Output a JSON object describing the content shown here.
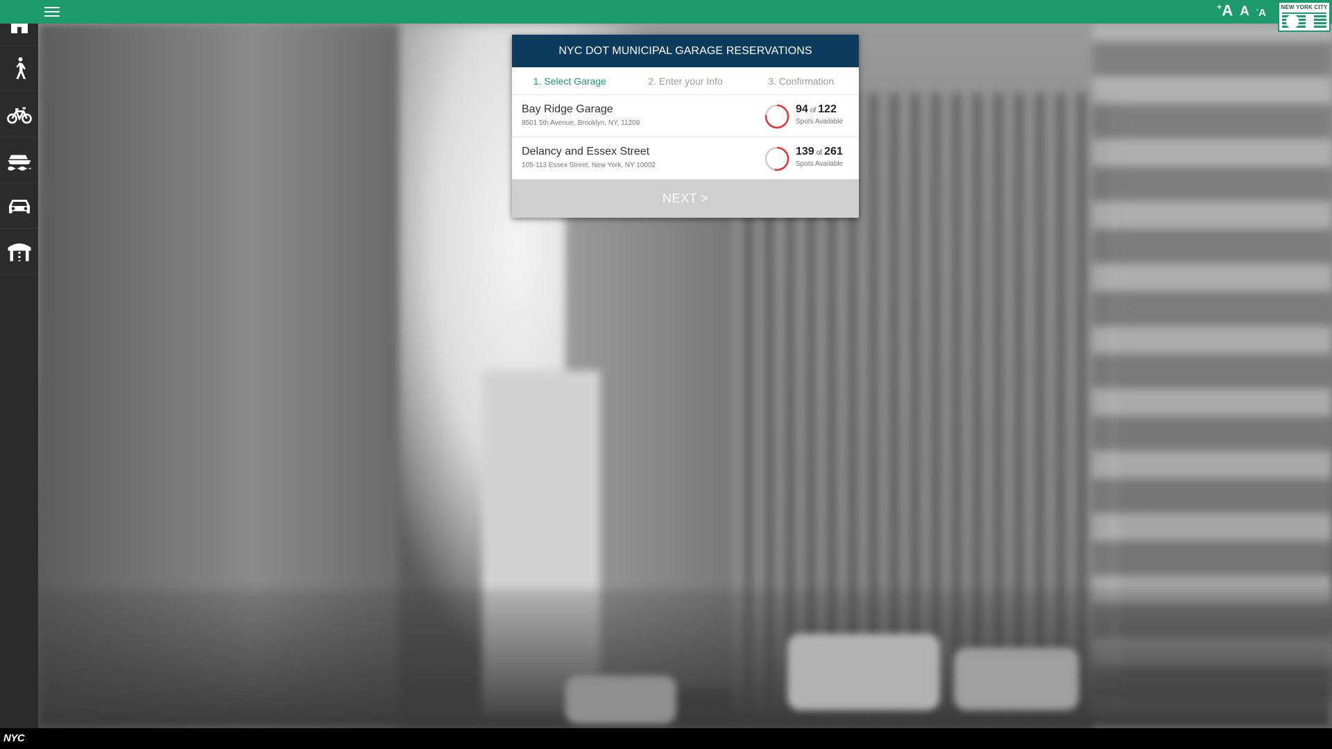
{
  "header": {
    "menu_icon": "hamburger-menu-icon",
    "font_controls": {
      "increase_label": "A",
      "normal_label": "A",
      "decrease_label": "A"
    },
    "logo_text": "NEW YORK CITY"
  },
  "sidebar": {
    "items": [
      {
        "name": "home",
        "icon": "home-icon"
      },
      {
        "name": "pedestrian",
        "icon": "pedestrian-icon"
      },
      {
        "name": "bicycle",
        "icon": "bicycle-icon"
      },
      {
        "name": "ferry",
        "icon": "ferry-icon"
      },
      {
        "name": "car",
        "icon": "car-icon"
      },
      {
        "name": "bridge",
        "icon": "bridge-icon"
      }
    ]
  },
  "panel": {
    "title": "NYC DOT MUNICIPAL GARAGE RESERVATIONS",
    "steps": [
      {
        "label": "1. Select Garage",
        "active": true
      },
      {
        "label": "2. Enter your Info",
        "active": false
      },
      {
        "label": "3. Confirmation",
        "active": false
      }
    ],
    "garages": [
      {
        "name": "Bay Ridge Garage",
        "address": "8501 5th Avenue, Brooklyn, NY, 11209",
        "available": "94",
        "of": "of",
        "total": "122",
        "label": "Spots Available",
        "ratio": 0.7705
      },
      {
        "name": "Delancy and Essex Street",
        "address": "105-113 Essex Street, New York, NY 10002",
        "available": "139",
        "of": "of",
        "total": "261",
        "label": "Spots Available",
        "ratio": 0.5326
      }
    ],
    "next_label": "NEXT >"
  },
  "footer": {
    "brand": "NYC"
  },
  "colors": {
    "topbar": "#1c9a6c",
    "panel_header": "#0d3b5e",
    "active_step": "#1c9a6c",
    "ring_used": "#e8322f",
    "ring_free": "#cccccc",
    "next_button": "#cfcfcf",
    "sidebar": "#2b2b2b"
  }
}
